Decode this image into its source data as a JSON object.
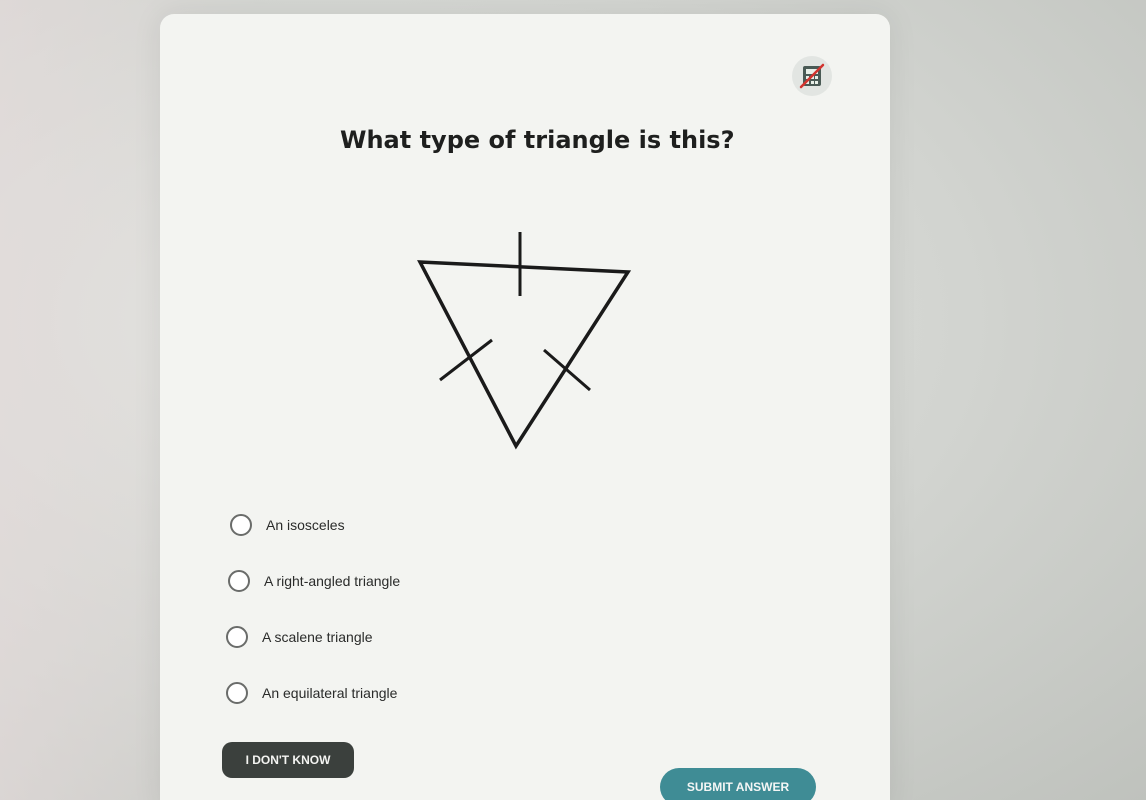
{
  "question": {
    "text": "What type of triangle is this?"
  },
  "toolbar": {
    "calculator_icon": "calculator-icon"
  },
  "figure": {
    "shape": "inverted triangle with equal-side tick marks",
    "stroke_color": "#1a1a1a"
  },
  "options": [
    {
      "label": "An isosceles"
    },
    {
      "label": "A right-angled triangle"
    },
    {
      "label": "A scalene triangle"
    },
    {
      "label": "An equilateral triangle"
    }
  ],
  "buttons": {
    "dont_know": "I DON'T KNOW",
    "submit": "SUBMIT ANSWER"
  },
  "colors": {
    "submit_bg": "#3f8c95",
    "dont_know_bg": "#3b403d",
    "card_bg": "#f3f4f1"
  }
}
